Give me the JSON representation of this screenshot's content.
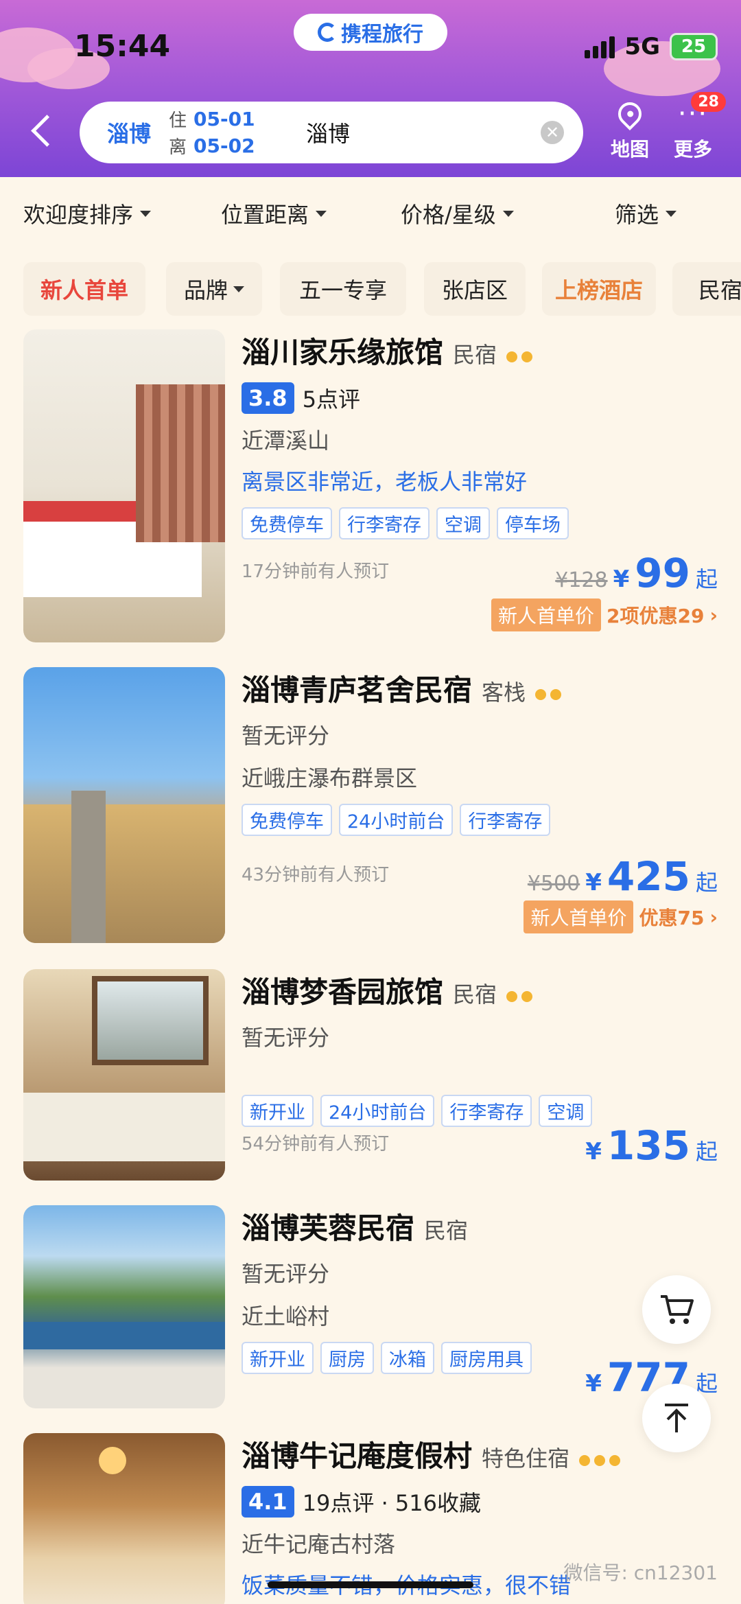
{
  "status_bar": {
    "time": "15:44",
    "network": "5G",
    "battery": "25"
  },
  "brand": {
    "name": "携程旅行"
  },
  "search": {
    "city": "淄博",
    "checkin_label": "住",
    "checkin_date": "05-01",
    "checkout_label": "离",
    "checkout_date": "05-02",
    "keyword": "淄博"
  },
  "header_actions": {
    "map_label": "地图",
    "more_label": "更多",
    "more_badge": "28"
  },
  "filters": [
    "欢迎度排序",
    "位置距离",
    "价格/星级",
    "筛选"
  ],
  "quick_tags": [
    "新人首单",
    "品牌",
    "五一专享",
    "张店区",
    "上榜酒店",
    "民宿"
  ],
  "hotels": [
    {
      "name": "淄川家乐缘旅馆",
      "type": "民宿",
      "stars": 2,
      "score": "3.8",
      "reviews": "5点评",
      "near": "近潭溪山",
      "highlight": "离景区非常近，老板人非常好",
      "tags": [
        "免费停车",
        "行李寄存",
        "空调",
        "停车场"
      ],
      "booked": "17分钟前有人预订",
      "orig_price": "¥128",
      "price": "99",
      "price_suffix": "起",
      "promo_badge": "新人首单价",
      "promo_text": "2项优惠29",
      "img_colors": [
        "#f4f1ea",
        "#d94040"
      ]
    },
    {
      "name": "淄博青庐茗舍民宿",
      "type": "客栈",
      "stars": 2,
      "noscore": "暂无评分",
      "near": "近峨庄瀑布群景区",
      "tags": [
        "免费停车",
        "24小时前台",
        "行李寄存"
      ],
      "booked": "43分钟前有人预订",
      "orig_price": "¥500",
      "price": "425",
      "price_suffix": "起",
      "promo_badge": "新人首单价",
      "promo_text": "优惠75"
    },
    {
      "name": "淄博梦香园旅馆",
      "type": "民宿",
      "stars": 2,
      "noscore": "暂无评分",
      "tags": [
        "新开业",
        "24小时前台",
        "行李寄存",
        "空调"
      ],
      "booked": "54分钟前有人预订",
      "price": "135",
      "price_suffix": "起"
    },
    {
      "name": "淄博芙蓉民宿",
      "type": "民宿",
      "noscore": "暂无评分",
      "near": "近土峪村",
      "tags": [
        "新开业",
        "厨房",
        "冰箱",
        "厨房用具"
      ],
      "price": "777",
      "price_suffix": "起"
    },
    {
      "name": "淄博牛记庵度假村",
      "type": "特色住宿",
      "stars": 3,
      "score": "4.1",
      "reviews": "19点评 · 516收藏",
      "near": "近牛记庵古村落",
      "highlight": "饭菜质量不错，价格实惠，很不错"
    }
  ],
  "currency": "¥",
  "watermark": "微信号: cn12301"
}
